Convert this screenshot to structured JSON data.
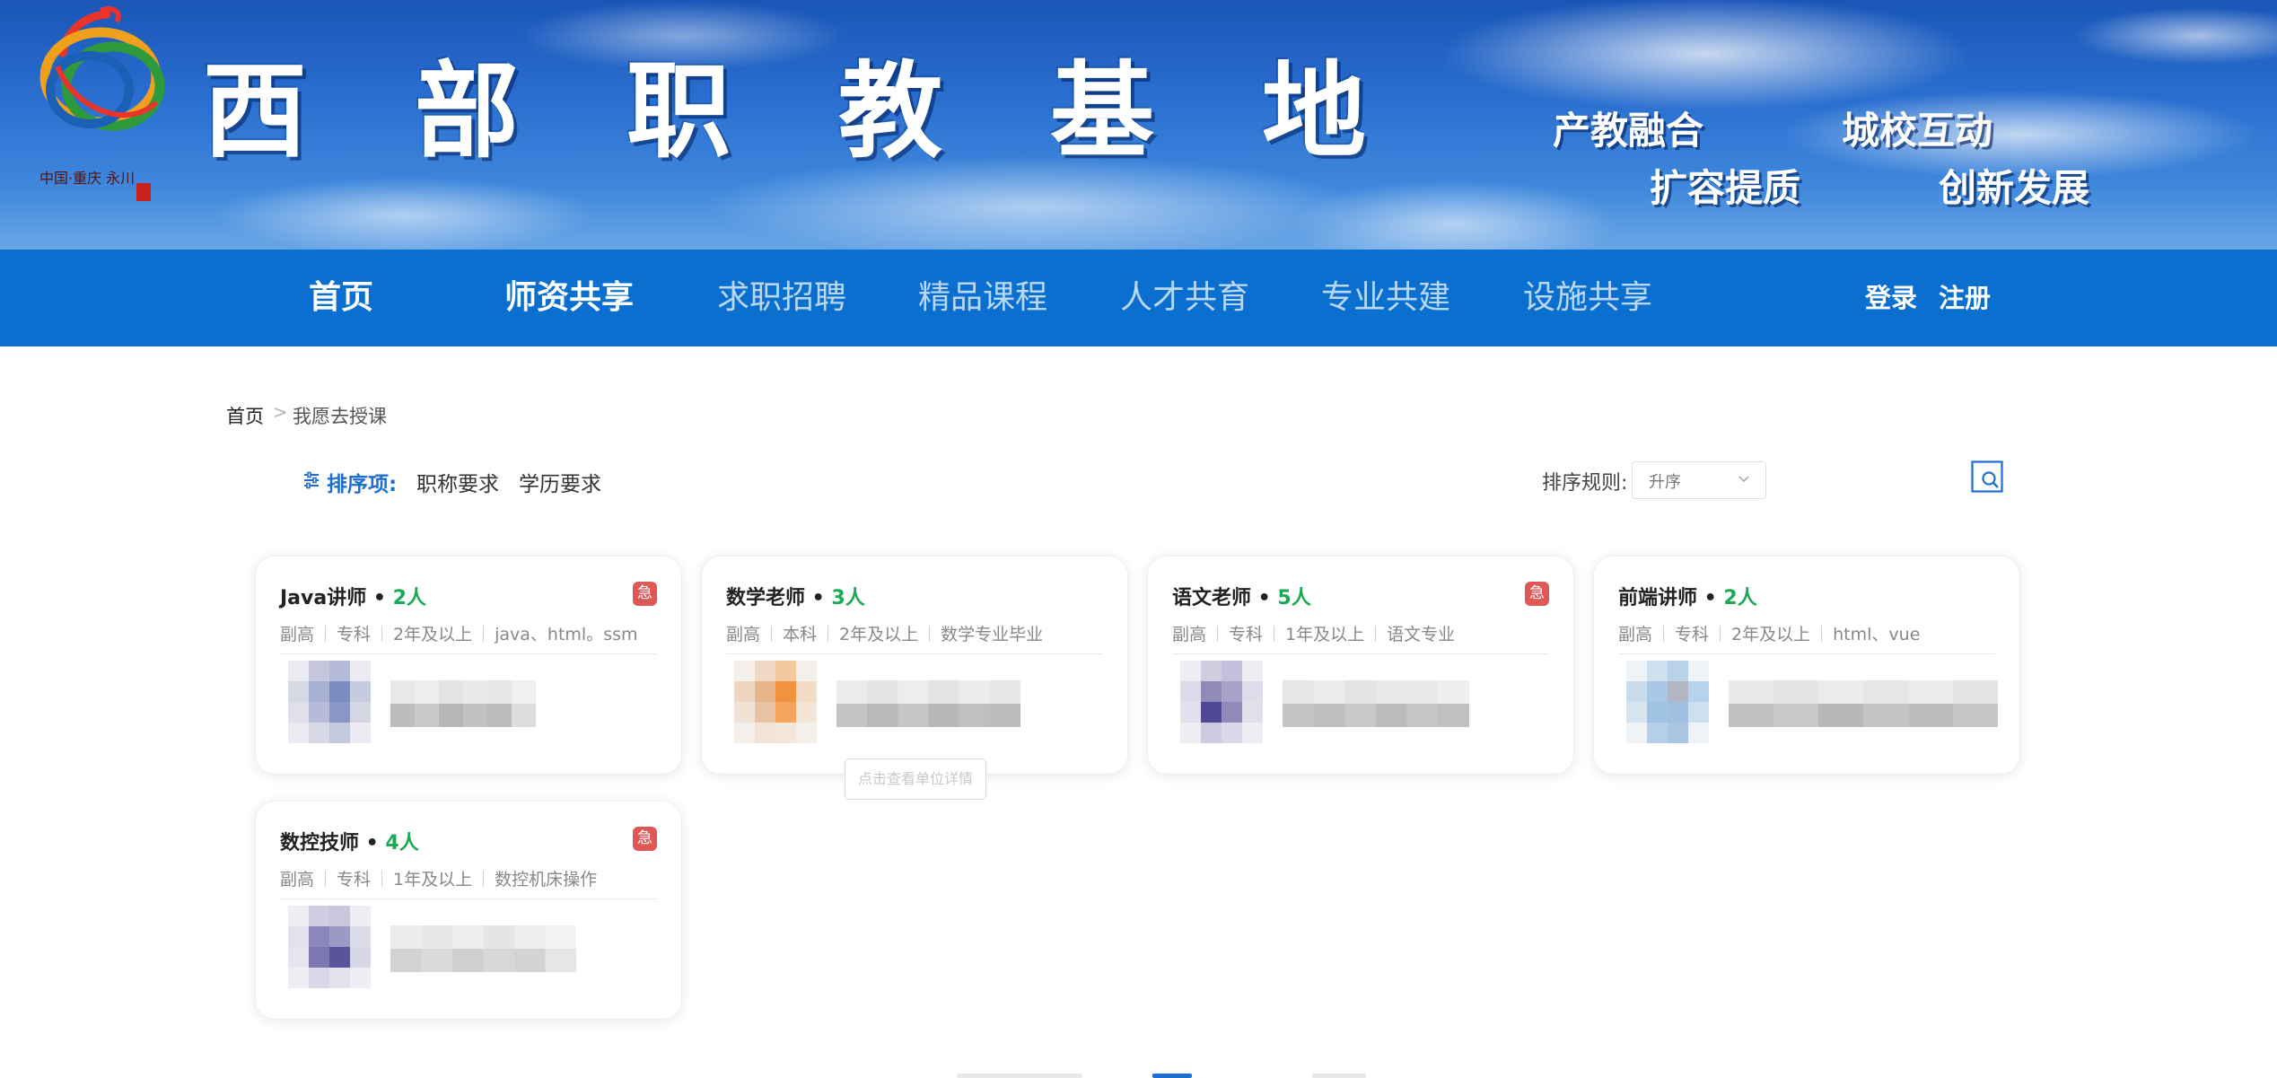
{
  "header": {
    "site_title": "西部职教基地",
    "slogans": [
      "产教融合",
      "城校互动",
      "扩容提质",
      "创新发展"
    ],
    "logo_text": "中国·重庆 永川"
  },
  "nav": {
    "items": [
      {
        "label": "首页"
      },
      {
        "label": "师资共享"
      },
      {
        "label": "求职招聘"
      },
      {
        "label": "精品课程"
      },
      {
        "label": "人才共育"
      },
      {
        "label": "专业共建"
      },
      {
        "label": "设施共享"
      }
    ],
    "login": "登录",
    "register": "注册"
  },
  "breadcrumb": {
    "home": "首页",
    "separator": ">",
    "current": "我愿去授课"
  },
  "filters": {
    "sort_label": "排序项:",
    "options": [
      "职称要求",
      "学历要求"
    ],
    "rule_label": "排序规则:",
    "rule_value": "升序"
  },
  "cards": [
    {
      "title": "Java讲师",
      "count": "2人",
      "urgent": "急",
      "tags": [
        "副高",
        "专科",
        "2年及以上",
        "java、html。ssm"
      ]
    },
    {
      "title": "数学老师",
      "count": "3人",
      "urgent": "",
      "tags": [
        "副高",
        "本科",
        "2年及以上",
        "数学专业毕业"
      ]
    },
    {
      "title": "语文老师",
      "count": "5人",
      "urgent": "急",
      "tags": [
        "副高",
        "专科",
        "1年及以上",
        "语文专业"
      ]
    },
    {
      "title": "前端讲师",
      "count": "2人",
      "urgent": "",
      "tags": [
        "副高",
        "专科",
        "2年及以上",
        "html、vue"
      ]
    },
    {
      "title": "数控技师",
      "count": "4人",
      "urgent": "急",
      "tags": [
        "副高",
        "专科",
        "1年及以上",
        "数控机床操作"
      ]
    }
  ],
  "tooltip": {
    "detail": "点击查看单位详情"
  },
  "colors": {
    "nav_bg": "#0a6fce",
    "accent": "#1f6fd1",
    "count_green": "#1aaa55",
    "urgent_red": "#e05757"
  },
  "icons": [
    "sort-settings-icon",
    "chevron-down-icon",
    "search-icon",
    "urgent-badge"
  ]
}
